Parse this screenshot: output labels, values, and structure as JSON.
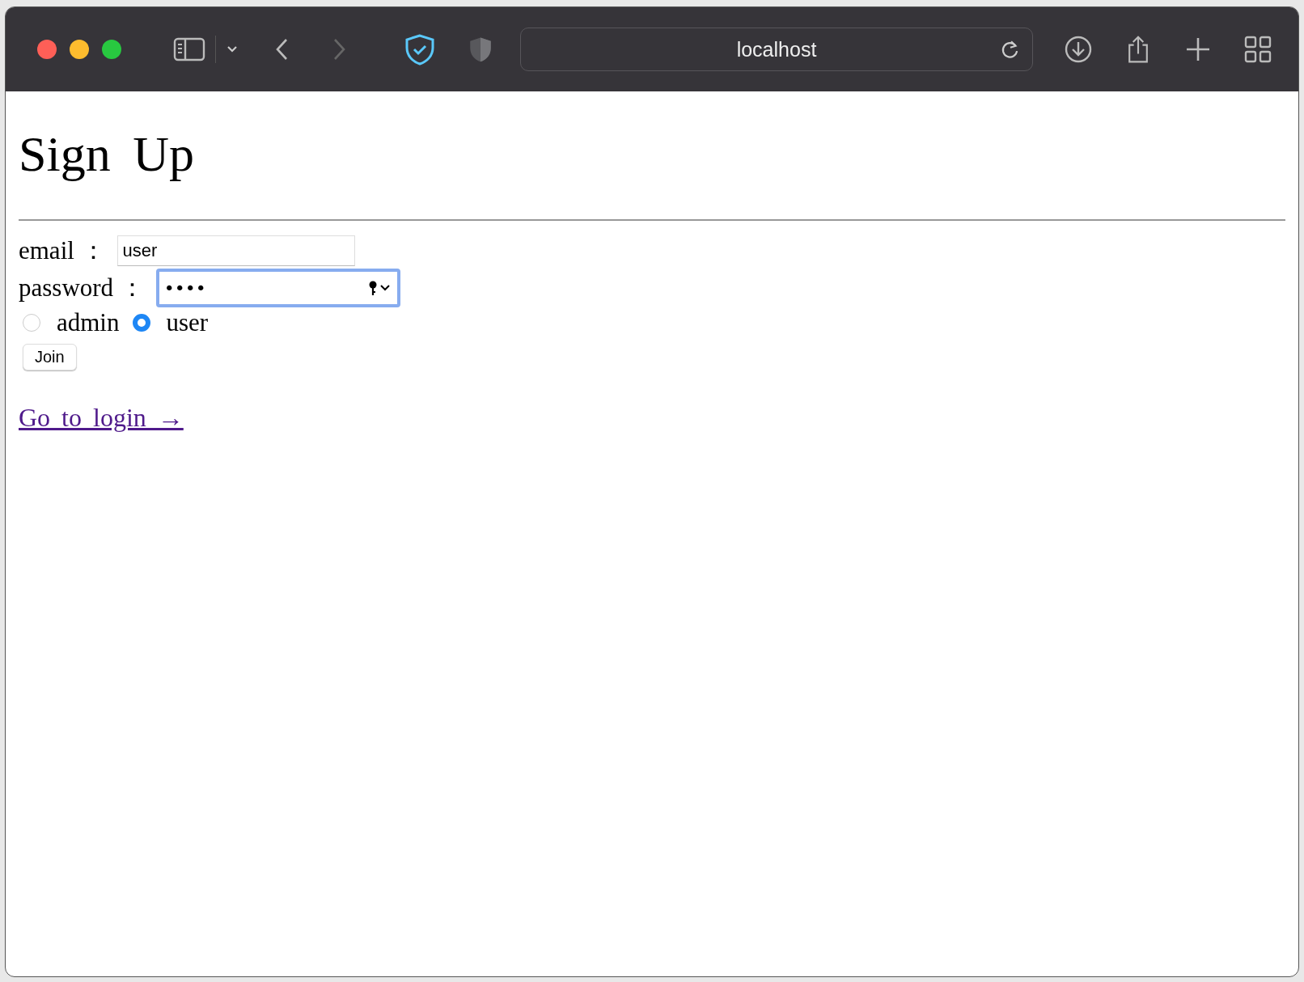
{
  "browser": {
    "address": "localhost"
  },
  "page": {
    "title": "Sign Up",
    "fields": [
      {
        "label": "email ：",
        "value": "user",
        "focused": false,
        "kind": "text"
      },
      {
        "label": "password ：",
        "value": "••••",
        "focused": true,
        "kind": "password"
      }
    ],
    "roles": [
      {
        "label": "admin",
        "selected": false
      },
      {
        "label": "user",
        "selected": true
      }
    ],
    "submit": "Join",
    "link": "Go to login →"
  }
}
